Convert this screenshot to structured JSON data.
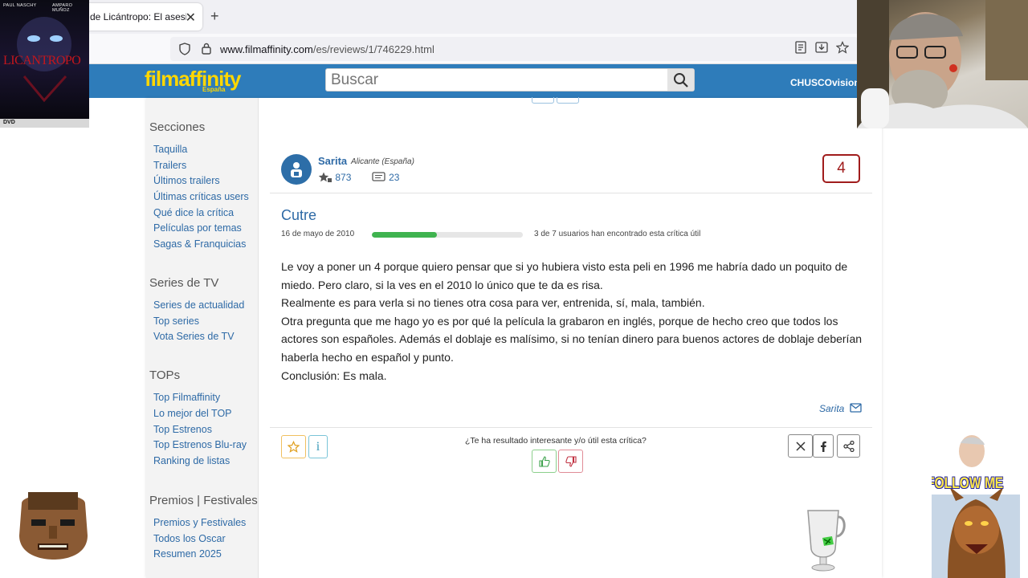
{
  "browser": {
    "tab_title": "de Licántropo: El asesino de la luna llena",
    "new_tab": "+",
    "url_domain": "www.filmaffinity.com",
    "url_path": "/es/reviews/1/746229.html"
  },
  "header": {
    "logo": "filmaffinity",
    "logo_sub": "España",
    "search_placeholder": "Buscar",
    "user": "CHUSCOvision"
  },
  "sidebar": {
    "sections": [
      {
        "title": "Secciones",
        "links": [
          "Taquilla",
          "Trailers",
          "Últimos trailers",
          "Últimas críticas users",
          "Qué dice la crítica",
          "Películas por temas",
          "Sagas & Franquicias"
        ]
      },
      {
        "title": "Series de TV",
        "links": [
          "Series de actualidad",
          "Top series",
          "Vota Series de TV"
        ]
      },
      {
        "title": "TOPs",
        "links": [
          "Top Filmaffinity",
          "Lo mejor del TOP",
          "Top Estrenos",
          "Top Estrenos Blu-ray",
          "Ranking de listas"
        ]
      },
      {
        "title": "Premios | Festivales",
        "links": [
          "Premios y Festivales",
          "Todos los Oscar",
          "Resumen 2025"
        ]
      }
    ]
  },
  "review": {
    "user_name": "Sarita",
    "user_location": "Alicante (España)",
    "user_ratings": "873",
    "user_reviews": "23",
    "rating": "4",
    "title": "Cutre",
    "date": "16 de mayo de 2010",
    "useful_fraction": 0.43,
    "useful_text": "3 de 7 usuarios han encontrado esta crítica útil",
    "body": [
      "Le voy a poner un 4 porque quiero pensar que si yo hubiera visto esta peli en 1996 me habría dado un poquito de miedo. Pero claro, si la ves en el 2010 lo único que te da es risa.",
      "Realmente es para verla si no tienes otra cosa para ver, entrenida, sí, mala, también.",
      "Otra pregunta que me hago yo es por qué la película la grabaron en inglés, porque de hecho creo que todos los actores son españoles. Además el doblaje es malísimo, si no tenían dinero para buenos actores de doblaje deberían haberla hecho en español y punto.",
      "Conclusión: Es mala."
    ],
    "signature": "Sarita",
    "question": "¿Te ha resultado interesante y/o útil esta crítica?",
    "info_icon": "i"
  },
  "overlays": {
    "poster_top_left": "PAUL NASCHY",
    "poster_top_right": "AMPARO MUÑOZ",
    "poster_title": "LICANTROPO",
    "poster_dvd": "DVD",
    "follow_text": "FOLLOW ME"
  },
  "colors": {
    "brand_blue": "#2e7cba",
    "logo_yellow": "#ffd700",
    "link_blue": "#2e6aa6",
    "rating_red": "#a01c1c",
    "progress_green": "#3fb34f"
  }
}
